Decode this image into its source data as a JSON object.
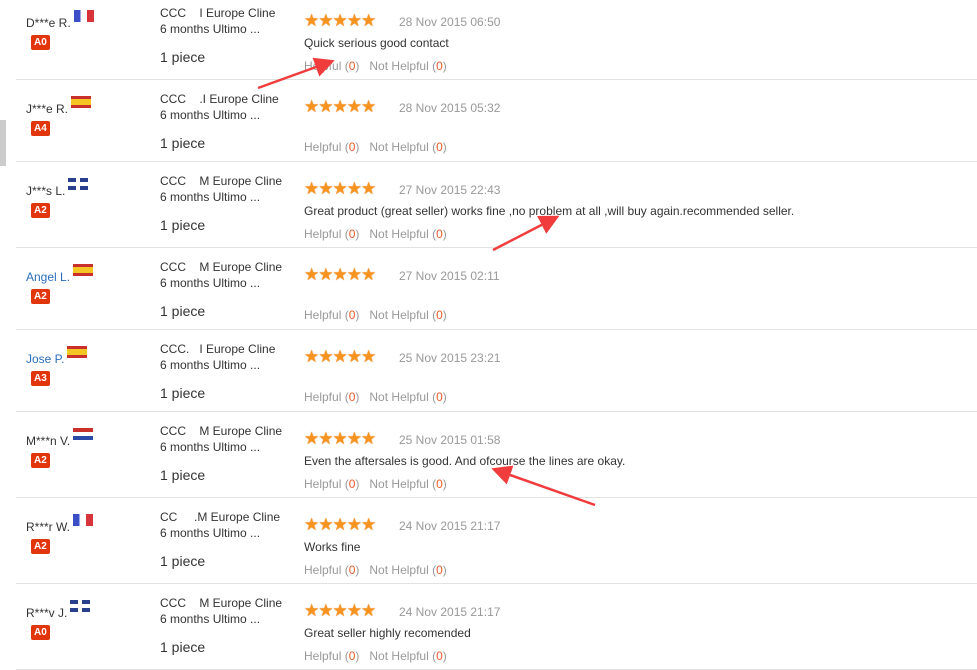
{
  "accent_color": "#f05a28",
  "helpful_label": "Helpful",
  "not_helpful_label": "Not Helpful",
  "reviews": [
    {
      "name": "D***e R.",
      "flag": "france-flag",
      "level": "A0",
      "product": "CCC    I Europe Cline\n6 months Ultimo ...",
      "quantity": "1 piece",
      "rating": 5,
      "date": "28 Nov 2015 06:50",
      "comment": "Quick serious good contact",
      "helpful": "0",
      "not_helpful": "0"
    },
    {
      "name": "J***e R.",
      "flag": "spain-flag",
      "level": "A4",
      "product": "CCC    .I Europe Cline\n6 months Ultimo ...",
      "quantity": "1 piece",
      "rating": 5,
      "date": "28 Nov 2015 05:32",
      "comment": "",
      "helpful": "0",
      "not_helpful": "0"
    },
    {
      "name": "J***s L.",
      "flag": "uk-flag",
      "level": "A2",
      "product": "CCC    M Europe Cline\n6 months Ultimo ...",
      "quantity": "1 piece",
      "rating": 5,
      "date": "27 Nov 2015 22:43",
      "comment": "Great product (great seller) works fine ,no problem at all ,will buy again.recommended seller.",
      "helpful": "0",
      "not_helpful": "0"
    },
    {
      "name": "Angel L.",
      "link": true,
      "flag": "spain-flag",
      "level": "A2",
      "product": "CCC    M Europe Cline\n6 months Ultimo ...",
      "quantity": "1 piece",
      "rating": 5,
      "date": "27 Nov 2015 02:11",
      "comment": "",
      "helpful": "0",
      "not_helpful": "0"
    },
    {
      "name": "Jose P.",
      "link": true,
      "flag": "spain-flag",
      "level": "A3",
      "product": "CCC.   I Europe Cline\n6 months Ultimo ...",
      "quantity": "1 piece",
      "rating": 5,
      "date": "25 Nov 2015 23:21",
      "comment": "",
      "helpful": "0",
      "not_helpful": "0"
    },
    {
      "name": "M***n V.",
      "flag": "netherlands-flag",
      "level": "A2",
      "product": "CCC    M Europe Cline\n6 months Ultimo ...",
      "quantity": "1 piece",
      "rating": 5,
      "date": "25 Nov 2015 01:58",
      "comment": "Even the aftersales is good. And ofcourse the lines are okay.",
      "helpful": "0",
      "not_helpful": "0"
    },
    {
      "name": "R***r W.",
      "flag": "france-flag",
      "level": "A2",
      "product": "CC     .M Europe Cline\n6 months Ultimo ...",
      "quantity": "1 piece",
      "rating": 5,
      "date": "24 Nov 2015 21:17",
      "comment": "Works fine",
      "helpful": "0",
      "not_helpful": "0"
    },
    {
      "name": "R***v J.",
      "flag": "uk-flag",
      "level": "A0",
      "product": "CCC    M Europe Cline\n6 months Ultimo ...",
      "quantity": "1 piece",
      "rating": 5,
      "date": "24 Nov 2015 21:17",
      "comment": "Great seller highly recomended",
      "helpful": "0",
      "not_helpful": "0"
    }
  ]
}
